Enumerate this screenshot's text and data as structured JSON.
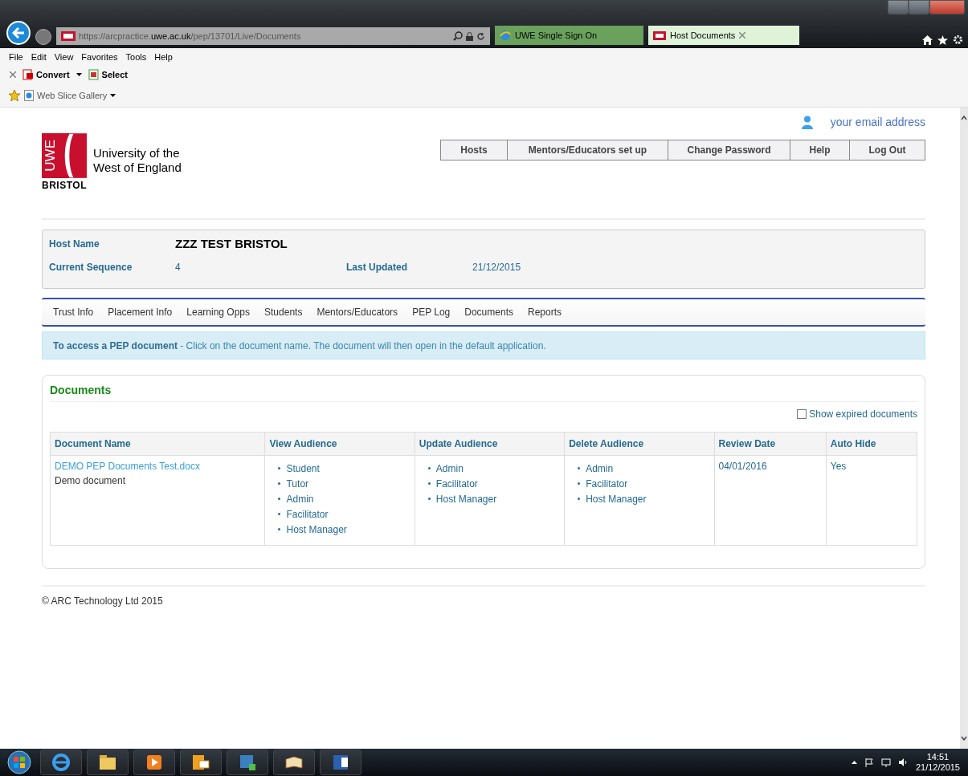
{
  "browser": {
    "address": "https://arcpractice.**uwe.ac.uk**/pep/13701/Live/Documents",
    "tabs": [
      {
        "title": "UWE Single Sign On",
        "selected": false
      },
      {
        "title": "Host Documents",
        "selected": true
      }
    ],
    "menu": [
      "File",
      "Edit",
      "View",
      "Favorites",
      "Tools",
      "Help"
    ],
    "commands": [
      {
        "label": "Convert",
        "kind": "dropdown"
      },
      {
        "label": "Select",
        "kind": "plain"
      }
    ],
    "favorites": [
      "Web Slice Gallery"
    ]
  },
  "header": {
    "logo": {
      "mark": "UWE",
      "place": "BRISTOL",
      "line1": "University of the",
      "line2": "West of England"
    },
    "user": "your email address",
    "nav": [
      "Hosts",
      "Mentors/Educators set up",
      "Change Password",
      "Help",
      "Log Out"
    ]
  },
  "host": {
    "rows": [
      [
        {
          "label": "Host Name",
          "value": "ZZZ TEST BRISTOL",
          "kind": "title"
        }
      ],
      [
        {
          "label": "Current Sequence",
          "value": "4",
          "kind": "plain"
        },
        {
          "label": "Last Updated",
          "value": "21/12/2015",
          "kind": "plain"
        }
      ]
    ]
  },
  "tabs": [
    "Trust Info",
    "Placement Info",
    "Learning Opps",
    "Students",
    "Mentors/Educators",
    "PEP Log",
    "Documents",
    "Reports"
  ],
  "notice": "**To access a PEP document** - Click on the document name. The document will then open in the default application.",
  "documents": {
    "title": "Documents",
    "show_expired": {
      "label": "Show expired documents",
      "checked": false
    },
    "columns": [
      "Document Name",
      "View Audience",
      "Update Audience",
      "Delete Audience",
      "Review Date",
      "Auto Hide"
    ],
    "rows": [
      {
        "document_name": "DEMO PEP Documents Test.docx",
        "description": "Demo document",
        "view_audience": [
          "Student",
          "Tutor",
          "Admin",
          "Facilitator",
          "Host Manager"
        ],
        "update_audience": [
          "Admin",
          "Facilitator",
          "Host Manager"
        ],
        "delete_audience": [
          "Admin",
          "Facilitator",
          "Host Manager"
        ],
        "review_date": "04/01/2016",
        "auto_hide": "Yes"
      }
    ]
  },
  "footer": "© ARC Technology Ltd 2015",
  "taskbar": {
    "time": "14:51",
    "date": "21/12/2015"
  }
}
